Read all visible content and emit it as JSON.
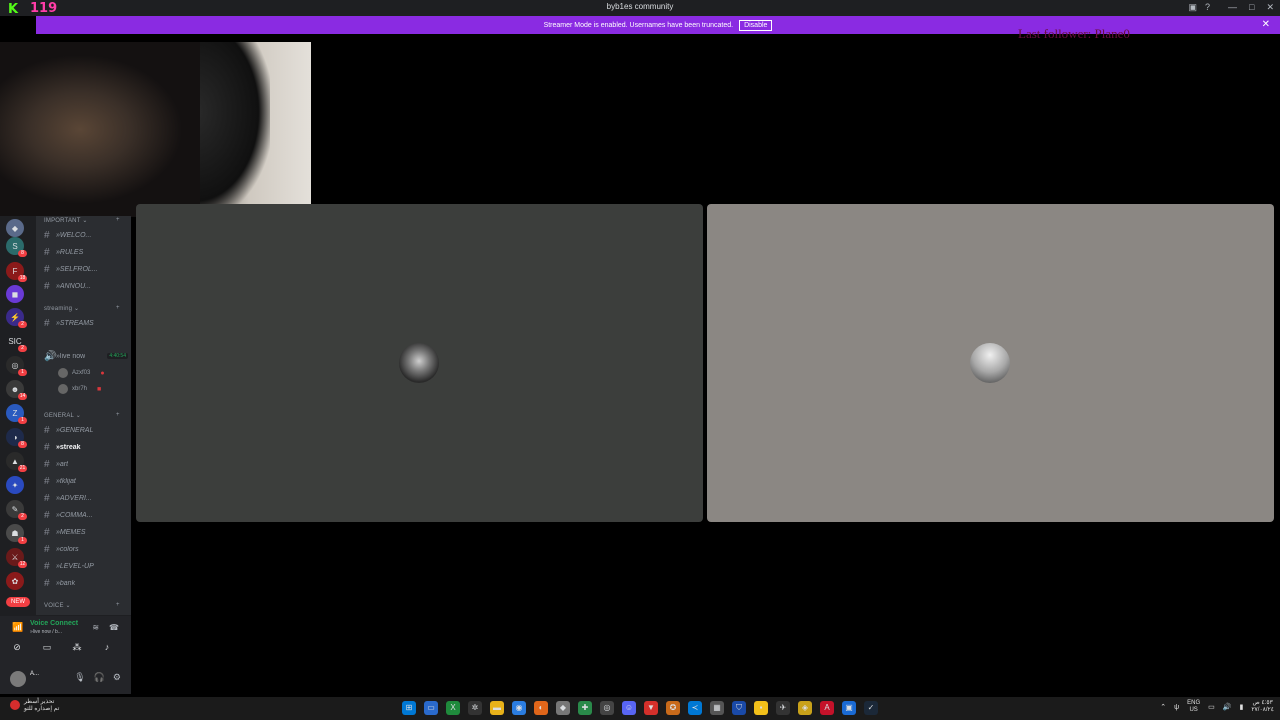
{
  "window": {
    "title": "byb1es community",
    "kick_logo": "K",
    "viewer_count": "119",
    "app_icons": [
      "inbox-icon",
      "help-icon"
    ],
    "controls": [
      "—",
      "□",
      "✕"
    ]
  },
  "banner": {
    "text": "Streamer Mode is enabled. Usernames have been truncated.",
    "disable_label": "Disable",
    "close": "✕"
  },
  "overlay": {
    "last_follower": "Last follower: Plane0"
  },
  "rail": {
    "badges": [
      "8",
      "18",
      "2",
      "2",
      "1",
      "14",
      "1",
      "8",
      "21",
      "2",
      "1",
      "12"
    ],
    "new_label": "NEW"
  },
  "sidebar": {
    "categories": {
      "important": "IMPORTANT",
      "streaming": "streaming",
      "general": "GENERAL",
      "voice": "VOICE"
    },
    "important_channels": [
      "»WELCO...",
      "»RULES",
      "»SELFROL...",
      "»ANNOU..."
    ],
    "streaming_channels": [
      "»STREAMS"
    ],
    "voice_channel": {
      "name": "»live now",
      "timer": "4:40:54"
    },
    "voice_users": [
      "Azxf03",
      "xbr7h"
    ],
    "general_channels": [
      "»GENERAL",
      "»streak",
      "»art",
      "»tklijat",
      "»ADVERI...",
      "»COMMA...",
      "»MEMES",
      "»colors",
      "»LEVEL-UP",
      "»bank"
    ]
  },
  "voice_panel": {
    "status": "Voice Connect",
    "location": "»live now / b..."
  },
  "user_panel": {
    "username": "A..."
  },
  "taskbar": {
    "notif_line1": "تحذير أسطر",
    "notif_line2": "تم إصداره للتو",
    "lang_line1": "ENG",
    "lang_line2": "US",
    "time": "٤:٥٣ ص",
    "date": "٢٧/٠٨/٢٤"
  },
  "colors": {
    "banner": "#8a2be2",
    "kick_green": "#53fc18",
    "viewer_pink": "#ff3da8",
    "voice_green": "#23a559",
    "mention_red": "#f23f43"
  }
}
